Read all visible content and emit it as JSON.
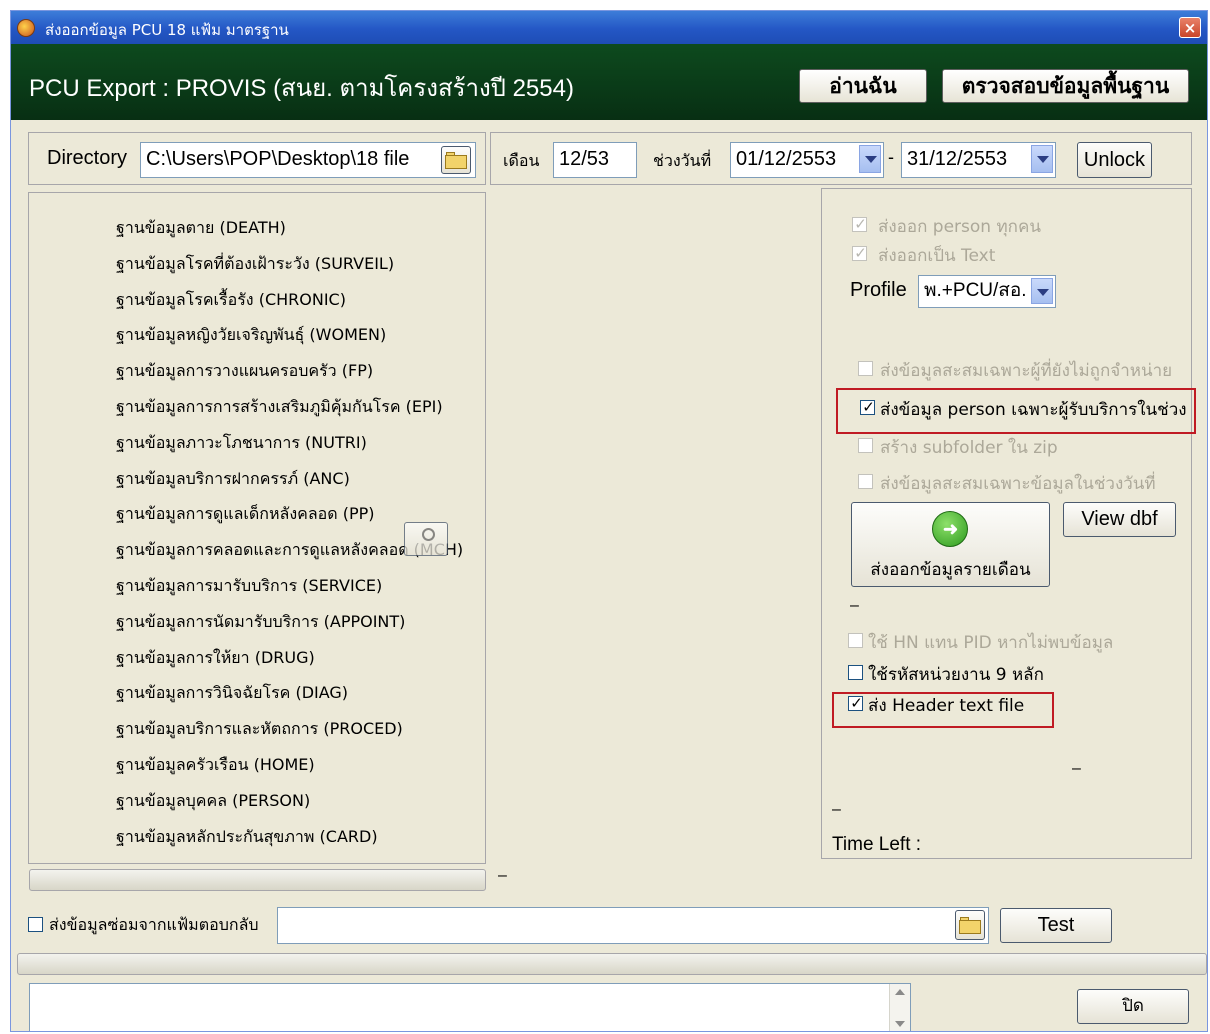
{
  "window": {
    "title": "ส่งออกข้อมูล PCU 18 แฟ้ม มาตรฐาน",
    "close_label": "×"
  },
  "header": {
    "title": "PCU Export : PROVIS (สนย. ตามโครงสร้างปี 2554)",
    "read_me_label": "อ่านฉัน",
    "check_base_label": "ตรวจสอบข้อมูลพื้นฐาน"
  },
  "directory": {
    "label": "Directory",
    "value": "C:\\Users\\POP\\Desktop\\18 file"
  },
  "period": {
    "month_label": "เดือน",
    "month_value": "12/53",
    "range_label": "ช่วงวันที่",
    "start_date": "01/12/2553",
    "separator": "-",
    "end_date": "31/12/2553",
    "unlock_label": "Unlock"
  },
  "file_list": [
    "ฐานข้อมูลตาย (DEATH)",
    "ฐานข้อมูลโรคที่ต้องเฝ้าระวัง (SURVEIL)",
    "ฐานข้อมูลโรคเรื้อรัง (CHRONIC)",
    "ฐานข้อมูลหญิงวัยเจริญพันธุ์ (WOMEN)",
    "ฐานข้อมูลการวางแผนครอบครัว (FP)",
    "ฐานข้อมูลการการสร้างเสริมภูมิคุ้มกันโรค (EPI)",
    "ฐานข้อมูลภาวะโภชนาการ (NUTRI)",
    "ฐานข้อมูลบริการฝากครรภ์ (ANC)",
    "ฐานข้อมูลการดูแลเด็กหลังคลอด (PP)",
    "ฐานข้อมูลการคลอดและการดูแลหลังคลอด (MCH)",
    "ฐานข้อมูลการมารับบริการ (SERVICE)",
    "ฐานข้อมูลการนัดมารับบริการ (APPOINT)",
    "ฐานข้อมูลการให้ยา (DRUG)",
    "ฐานข้อมูลการวินิจฉัยโรค (DIAG)",
    "ฐานข้อมูลบริการและหัตถการ (PROCED)",
    "ฐานข้อมูลครัวเรือน (HOME)",
    "ฐานข้อมูลบุคคล (PERSON)",
    "ฐานข้อมูลหลักประกันสุขภาพ (CARD)"
  ],
  "options": {
    "export_all_person": "ส่งออก person ทุกคน",
    "export_as_text": "ส่งออกเป็น Text",
    "profile_label": "Profile",
    "profile_value": "พ.+PCU/สอ.",
    "accum_not_discharged": "ส่งข้อมูลสะสมเฉพาะผู้ที่ยังไม่ถูกจำหน่าย",
    "person_service_in_range": "ส่งข้อมูล person เฉพาะผู้รับบริการในช่วง",
    "create_subfolder_zip": "สร้าง subfolder ใน zip",
    "accum_in_range": "ส่งข้อมูลสะสมเฉพาะข้อมูลในช่วงวันที่",
    "export_monthly_label": "ส่งออกข้อมูลรายเดือน",
    "view_dbf_label": "View dbf",
    "dash": "–",
    "use_hn_instead_pid": "ใช้ HN แทน PID หากไม่พบข้อมูล",
    "use_unit_code_9": "ใช้รหัสหน่วยงาน 9 หลัก",
    "send_header_text": "ส่ง Header text file",
    "time_left_label": "Time Left :"
  },
  "bottom": {
    "resend_label": "ส่งข้อมูลซ่อมจากแฟ้มตอบกลับ",
    "test_label": "Test",
    "close_label": "ปิด"
  },
  "colors": {
    "header_bg": "#0a3d18",
    "titlebar": "#2457c5",
    "highlight": "#c01b24"
  }
}
